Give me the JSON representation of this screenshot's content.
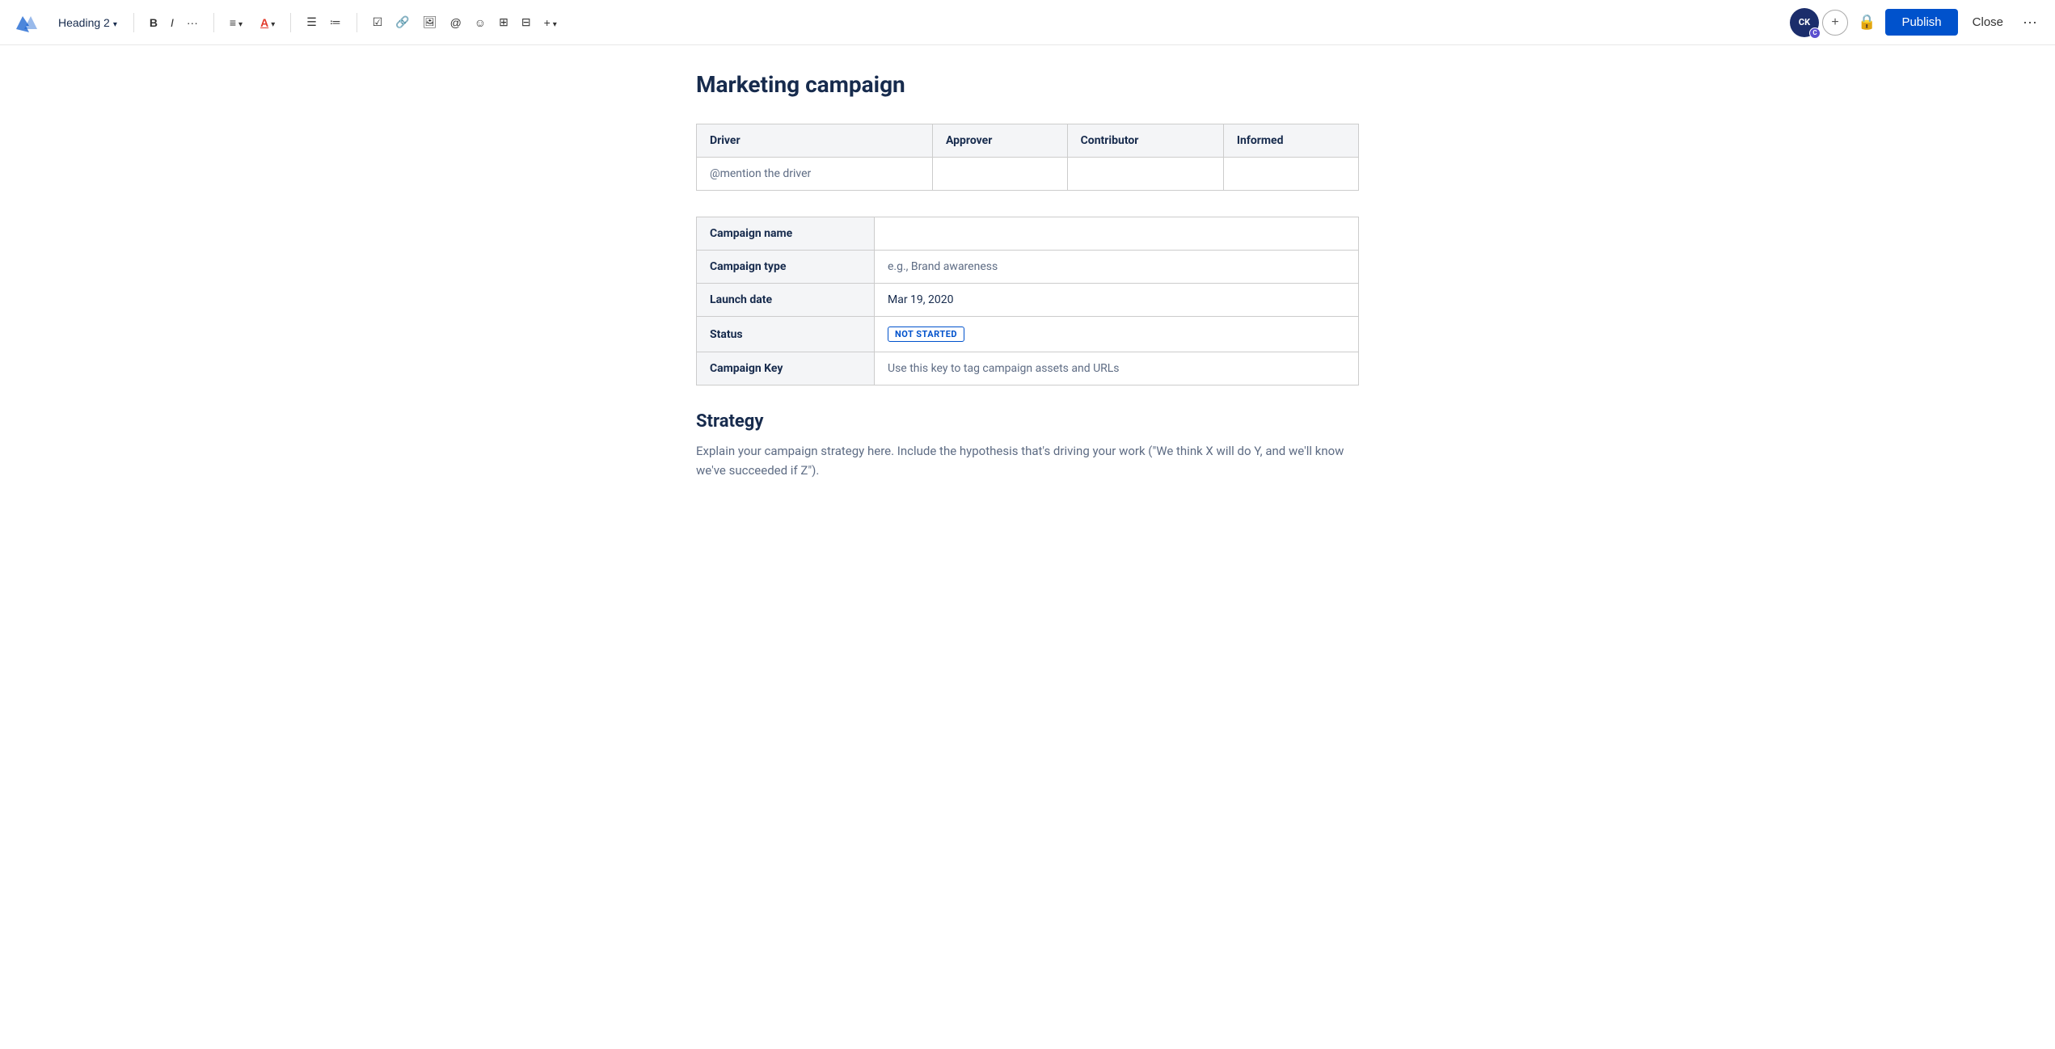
{
  "toolbar": {
    "heading_label": "Heading 2",
    "buttons": {
      "bold": "B",
      "italic": "I",
      "more_text": "···",
      "align": "≡",
      "color": "A",
      "bullet_list": "☰",
      "ordered_list": "≡",
      "task": "☑",
      "link": "🔗",
      "image": "🖼",
      "mention": "@",
      "emoji": "☺",
      "table": "⊞",
      "layout": "⊟",
      "insert": "+",
      "add_user": "+",
      "lock": "🔒",
      "publish": "Publish",
      "close": "Close",
      "more": "···"
    },
    "avatar_initials": "CK",
    "avatar_badge": "C"
  },
  "page": {
    "title": "Marketing campaign"
  },
  "daci_table": {
    "columns": [
      "Driver",
      "Approver",
      "Contributor",
      "Informed"
    ],
    "row": {
      "driver_placeholder": "@mention the driver",
      "approver_placeholder": "",
      "contributor_placeholder": "",
      "informed_placeholder": ""
    }
  },
  "info_table": {
    "rows": [
      {
        "label": "Campaign name",
        "value": ""
      },
      {
        "label": "Campaign type",
        "value": "e.g., Brand awareness"
      },
      {
        "label": "Launch date",
        "value": "Mar 19, 2020"
      },
      {
        "label": "Status",
        "value": "NOT STARTED",
        "is_badge": true
      },
      {
        "label": "Campaign Key",
        "value": "Use this key to tag campaign assets and URLs"
      }
    ]
  },
  "strategy": {
    "heading": "Strategy",
    "body": "Explain your campaign strategy here. Include the hypothesis that's driving your work (\"We think X will do Y, and we'll know we've succeeded if Z\")."
  }
}
